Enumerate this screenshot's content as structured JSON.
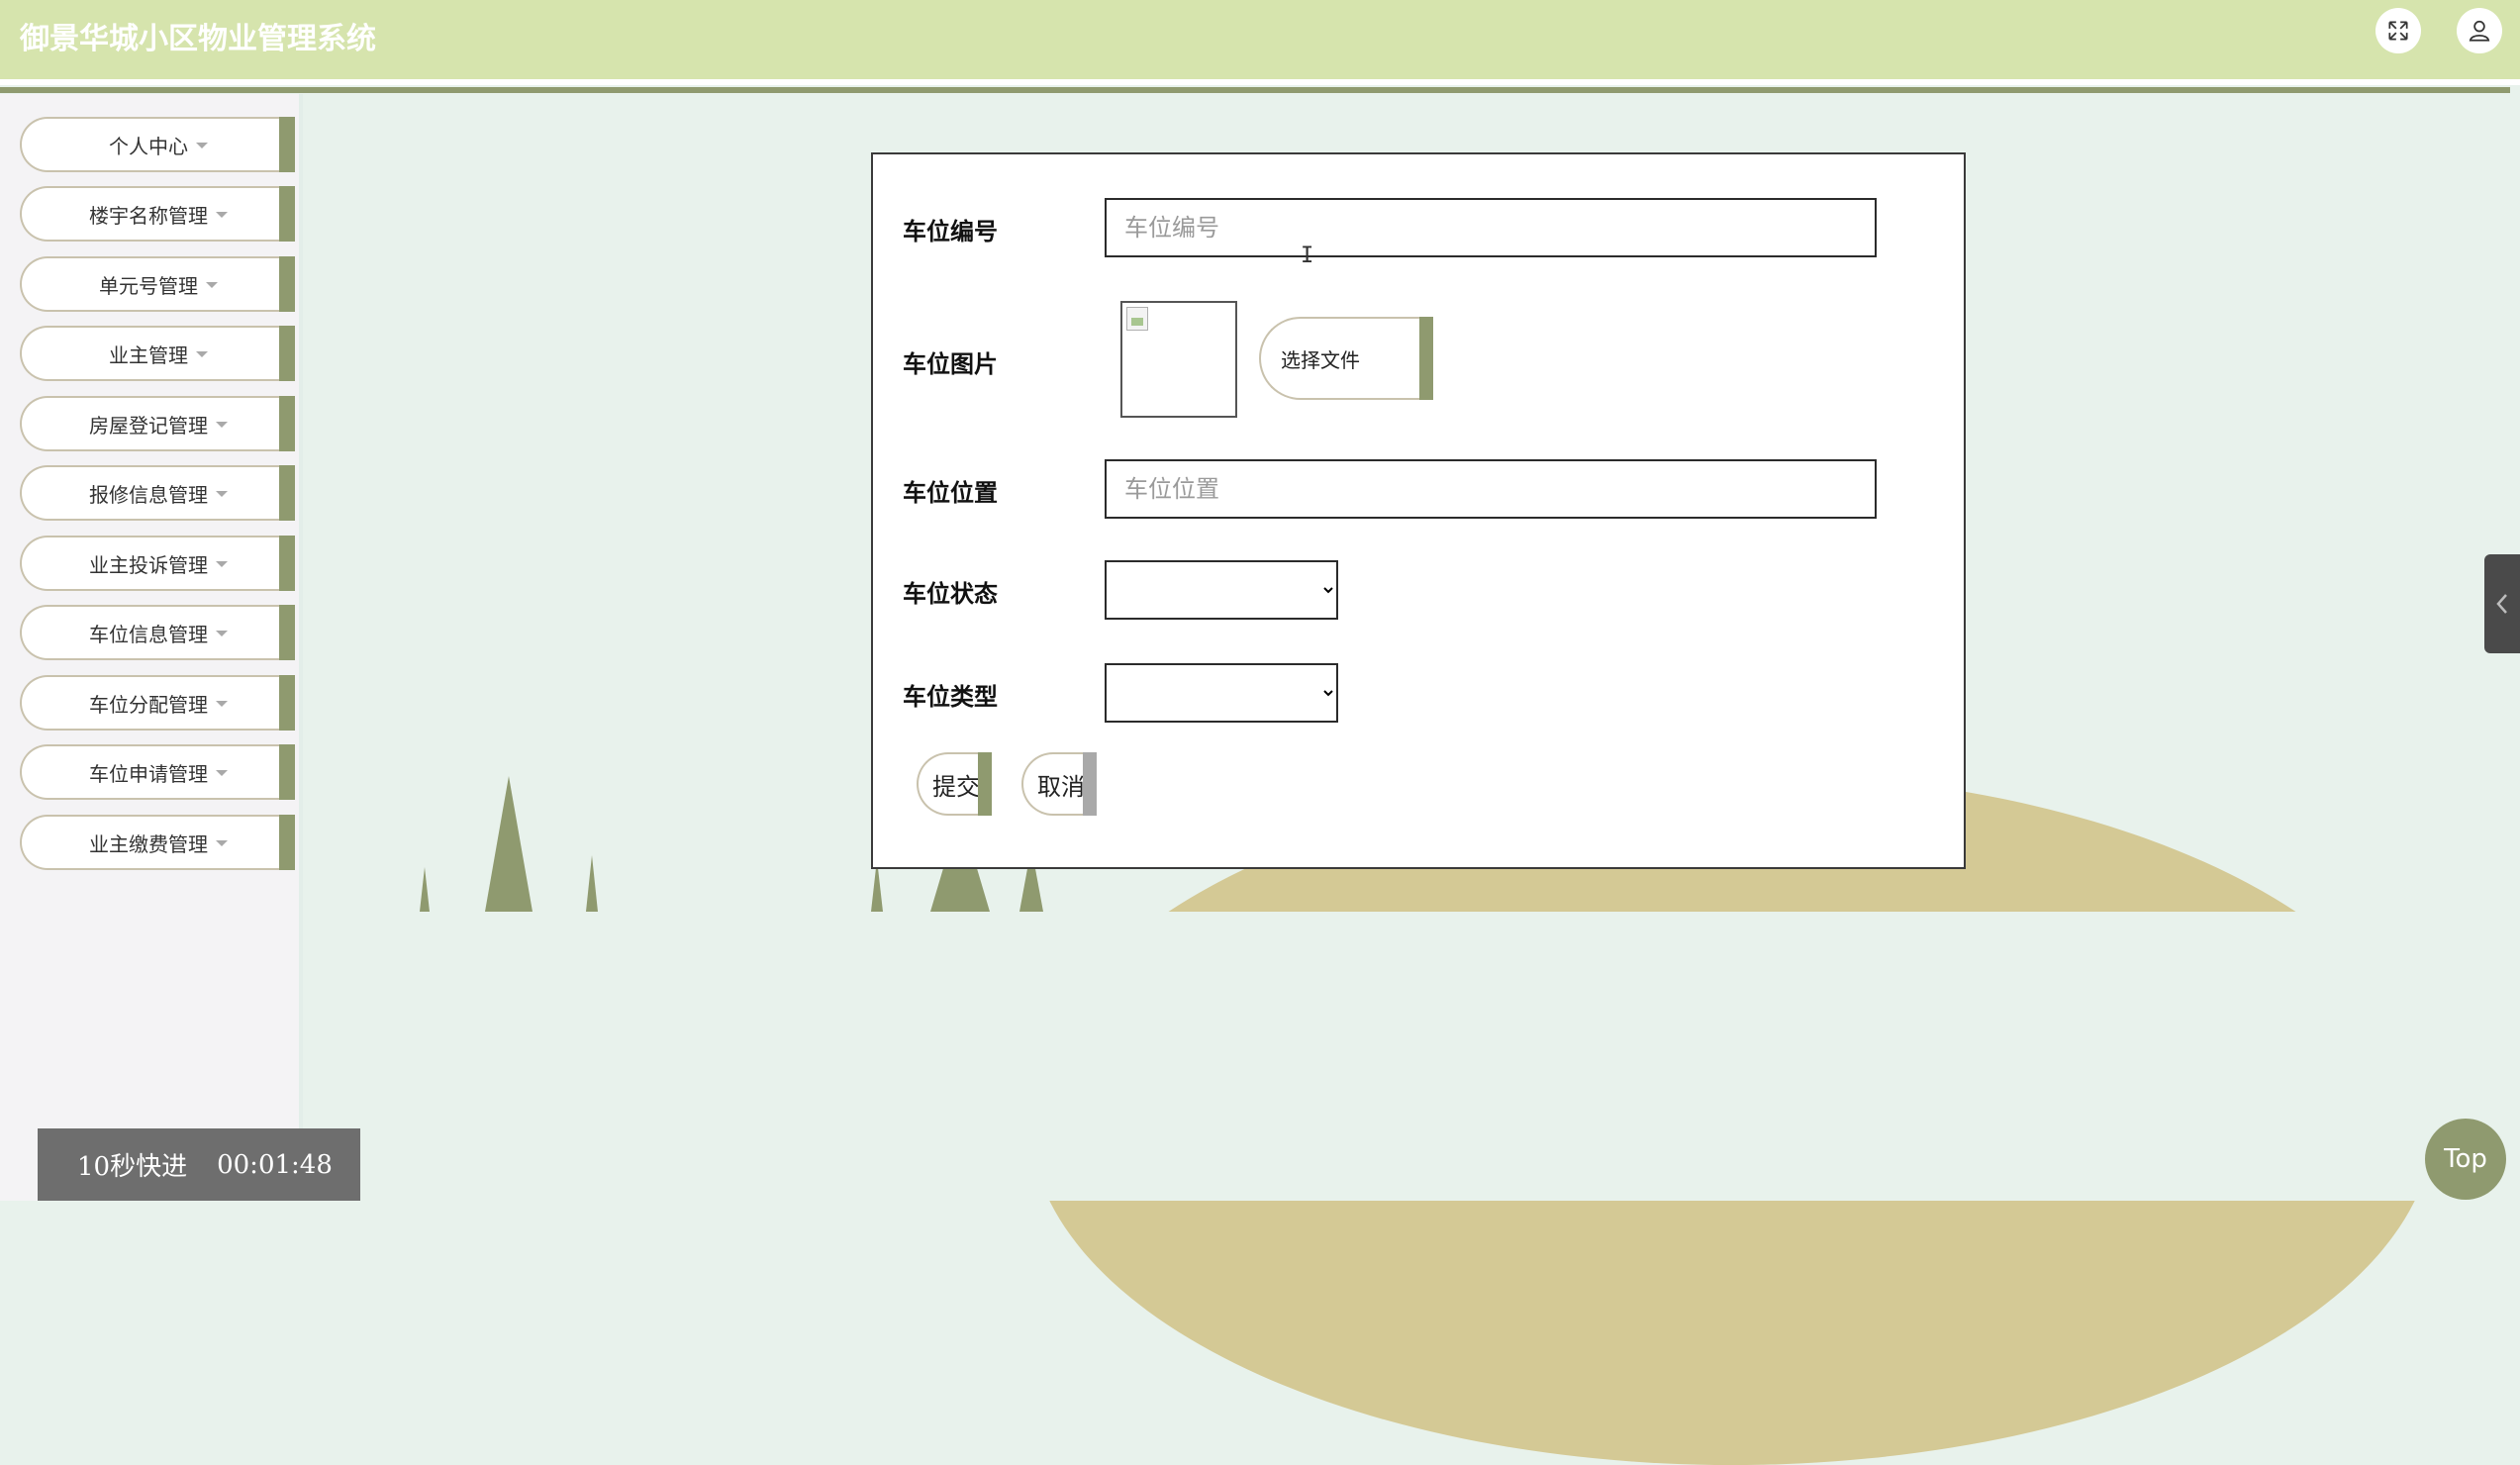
{
  "header": {
    "title": "御景华城小区物业管理系统",
    "fullscreen_icon": "expand-icon",
    "user_icon": "user-icon"
  },
  "sidebar": {
    "items": [
      {
        "label": "个人中心"
      },
      {
        "label": "楼宇名称管理"
      },
      {
        "label": "单元号管理"
      },
      {
        "label": "业主管理"
      },
      {
        "label": "房屋登记管理"
      },
      {
        "label": "报修信息管理"
      },
      {
        "label": "业主投诉管理"
      },
      {
        "label": "车位信息管理"
      },
      {
        "label": "车位分配管理"
      },
      {
        "label": "车位申请管理"
      },
      {
        "label": "业主缴费管理"
      }
    ]
  },
  "form": {
    "space_no_label": "车位编号",
    "space_no_placeholder": "车位编号",
    "space_no_value": "",
    "image_label": "车位图片",
    "choose_file_label": "选择文件",
    "location_label": "车位位置",
    "location_placeholder": "车位位置",
    "location_value": "",
    "status_label": "车位状态",
    "status_value": "",
    "type_label": "车位类型",
    "type_value": "",
    "submit_label": "提交",
    "cancel_label": "取消"
  },
  "timer": {
    "skip_label": "10秒快进",
    "time": "00:01:48"
  },
  "top_button": {
    "label": "Top"
  },
  "colors": {
    "header_bg": "#d6e4ad",
    "accent": "#8f9a6f",
    "page_bg": "#e8f2ec",
    "sidebar_bg": "#f4f3f5",
    "hill": "#d4c995"
  }
}
